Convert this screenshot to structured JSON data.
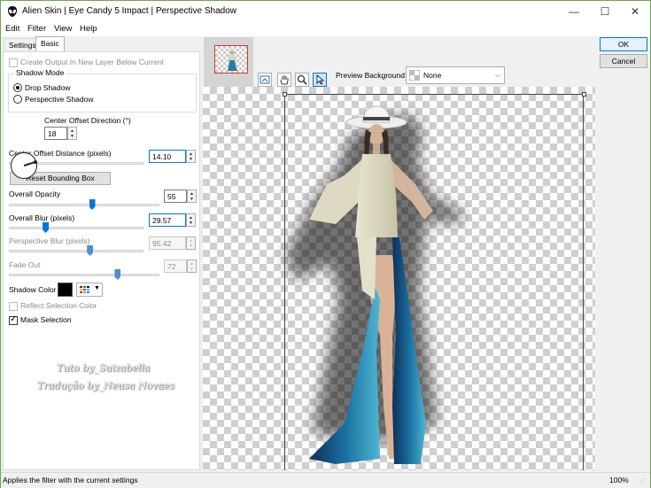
{
  "window": {
    "title": "Alien Skin | Eye Candy 5 Impact | Perspective Shadow",
    "minimize_glyph": "—",
    "maximize_glyph": "☐",
    "close_glyph": "✕"
  },
  "menu": [
    "Edit",
    "Filter",
    "View",
    "Help"
  ],
  "tabs": [
    "Settings",
    "Basic"
  ],
  "basic": {
    "create_output_label": "Create Output In New Layer Below Current",
    "shadow_mode_title": "Shadow Mode",
    "drop_shadow_label": "Drop Shadow",
    "perspective_shadow_label": "Perspective Shadow",
    "selected_mode": "Drop Shadow",
    "center_offset_direction_label": "Center Offset Direction (°)",
    "center_offset_direction_value": "18",
    "center_offset_distance_label": "Center Offset Distance (pixels)",
    "center_offset_distance_value": "14.10",
    "reset_bounding_box_label": "Reset Bounding Box",
    "overall_opacity_label": "Overall Opacity",
    "overall_opacity_value": "55",
    "overall_blur_label": "Overall Blur (pixels)",
    "overall_blur_value": "29.57",
    "perspective_blur_label": "Perspective Blur (pixels)",
    "perspective_blur_value": "95.42",
    "fade_out_label": "Fade Out",
    "fade_out_value": "72",
    "shadow_color_label": "Shadow Color",
    "shadow_color": "#000000",
    "reflect_selection_color_label": "Reflect Selection Color",
    "mask_selection_label": "Mask Selection",
    "mask_selection_checked": true
  },
  "sliders": {
    "center_offset_distance": 0.09,
    "overall_opacity": 0.55,
    "overall_blur": 0.27,
    "perspective_blur": 0.6,
    "fade_out": 0.72
  },
  "watermark": {
    "line1": "Tuto by_Suizabella",
    "line2": "Tradução by_Neusa Novaes"
  },
  "preview": {
    "background_label": "Preview Background:",
    "background_value": "None"
  },
  "buttons": {
    "ok": "OK",
    "cancel": "Cancel"
  },
  "status": {
    "text": "Applies the filter with the current settings",
    "zoom": "100%"
  }
}
